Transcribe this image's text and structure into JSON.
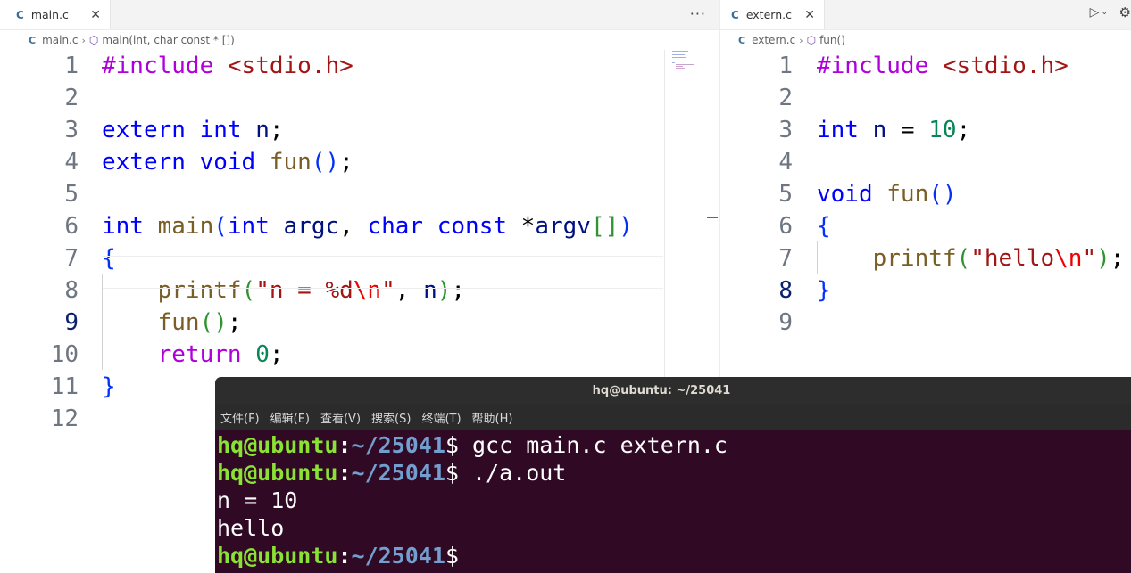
{
  "left_editor": {
    "tab": {
      "icon": "C",
      "label": "main.c"
    },
    "more_actions": "···",
    "breadcrumb": {
      "file_icon": "C",
      "file": "main.c",
      "symbol": "main(int, char const * [])"
    },
    "active_line": 9,
    "lines": [
      {
        "n": "1",
        "tokens": [
          {
            "t": "#include",
            "c": "inc"
          },
          {
            "t": " "
          },
          {
            "t": "<stdio.h>",
            "c": "str"
          }
        ]
      },
      {
        "n": "2",
        "tokens": []
      },
      {
        "n": "3",
        "tokens": [
          {
            "t": "extern",
            "c": "kw"
          },
          {
            "t": " "
          },
          {
            "t": "int",
            "c": "kw"
          },
          {
            "t": " "
          },
          {
            "t": "n",
            "c": "var"
          },
          {
            "t": ";"
          }
        ]
      },
      {
        "n": "4",
        "tokens": [
          {
            "t": "extern",
            "c": "kw"
          },
          {
            "t": " "
          },
          {
            "t": "void",
            "c": "kw"
          },
          {
            "t": " "
          },
          {
            "t": "fun",
            "c": "fn"
          },
          {
            "t": "()",
            "c": "br1"
          },
          {
            "t": ";"
          }
        ]
      },
      {
        "n": "5",
        "tokens": []
      },
      {
        "n": "6",
        "tokens": [
          {
            "t": "int",
            "c": "kw"
          },
          {
            "t": " "
          },
          {
            "t": "main",
            "c": "fn"
          },
          {
            "t": "(",
            "c": "br1"
          },
          {
            "t": "int",
            "c": "kw"
          },
          {
            "t": " "
          },
          {
            "t": "argc",
            "c": "var"
          },
          {
            "t": ", "
          },
          {
            "t": "char",
            "c": "kw"
          },
          {
            "t": " "
          },
          {
            "t": "const",
            "c": "kw"
          },
          {
            "t": " *"
          },
          {
            "t": "argv",
            "c": "var"
          },
          {
            "t": "[]",
            "c": "br2"
          },
          {
            "t": ")",
            "c": "br1"
          }
        ]
      },
      {
        "n": "7",
        "tokens": [
          {
            "t": "{",
            "c": "br1"
          }
        ]
      },
      {
        "n": "8",
        "tokens": [
          {
            "t": "    "
          },
          {
            "t": "printf",
            "c": "fn"
          },
          {
            "t": "(",
            "c": "br2"
          },
          {
            "t": "\"n = %d",
            "c": "str"
          },
          {
            "t": "\\n",
            "c": "esc"
          },
          {
            "t": "\"",
            "c": "str"
          },
          {
            "t": ", "
          },
          {
            "t": "n",
            "c": "var"
          },
          {
            "t": ")",
            "c": "br2"
          },
          {
            "t": ";"
          }
        ]
      },
      {
        "n": "9",
        "tokens": [
          {
            "t": "    "
          },
          {
            "t": "fun",
            "c": "fn"
          },
          {
            "t": "()",
            "c": "br2"
          },
          {
            "t": ";"
          }
        ]
      },
      {
        "n": "10",
        "tokens": [
          {
            "t": "    "
          },
          {
            "t": "return",
            "c": "ctl"
          },
          {
            "t": " "
          },
          {
            "t": "0",
            "c": "num"
          },
          {
            "t": ";"
          }
        ]
      },
      {
        "n": "11",
        "tokens": [
          {
            "t": "}",
            "c": "br1"
          }
        ]
      },
      {
        "n": "12",
        "tokens": []
      }
    ]
  },
  "right_editor": {
    "tab": {
      "icon": "C",
      "label": "extern.c"
    },
    "breadcrumb": {
      "file_icon": "C",
      "file": "extern.c",
      "symbol": "fun()"
    },
    "active_line": 8,
    "lines": [
      {
        "n": "1",
        "tokens": [
          {
            "t": "#include",
            "c": "inc"
          },
          {
            "t": " "
          },
          {
            "t": "<stdio.h>",
            "c": "str"
          }
        ]
      },
      {
        "n": "2",
        "tokens": []
      },
      {
        "n": "3",
        "tokens": [
          {
            "t": "int",
            "c": "kw"
          },
          {
            "t": " "
          },
          {
            "t": "n",
            "c": "var"
          },
          {
            "t": " = "
          },
          {
            "t": "10",
            "c": "num"
          },
          {
            "t": ";"
          }
        ]
      },
      {
        "n": "4",
        "tokens": []
      },
      {
        "n": "5",
        "tokens": [
          {
            "t": "void",
            "c": "kw"
          },
          {
            "t": " "
          },
          {
            "t": "fun",
            "c": "fn"
          },
          {
            "t": "()",
            "c": "br1"
          }
        ]
      },
      {
        "n": "6",
        "tokens": [
          {
            "t": "{",
            "c": "br1"
          }
        ]
      },
      {
        "n": "7",
        "tokens": [
          {
            "t": "    "
          },
          {
            "t": "printf",
            "c": "fn"
          },
          {
            "t": "(",
            "c": "br2"
          },
          {
            "t": "\"hello",
            "c": "str"
          },
          {
            "t": "\\n",
            "c": "esc"
          },
          {
            "t": "\"",
            "c": "str"
          },
          {
            "t": ")",
            "c": "br2"
          },
          {
            "t": ";"
          }
        ]
      },
      {
        "n": "8",
        "tokens": [
          {
            "t": "}",
            "c": "br1"
          }
        ]
      },
      {
        "n": "9",
        "tokens": []
      }
    ]
  },
  "terminal": {
    "title": "hq@ubuntu: ~/25041",
    "menu": [
      "文件(F)",
      "编辑(E)",
      "查看(V)",
      "搜索(S)",
      "终端(T)",
      "帮助(H)"
    ],
    "lines": [
      {
        "prompt": true,
        "user": "hq@ubuntu",
        "path": "~/25041",
        "cmd": " gcc main.c extern.c"
      },
      {
        "prompt": true,
        "user": "hq@ubuntu",
        "path": "~/25041",
        "cmd": " ./a.out"
      },
      {
        "prompt": false,
        "text": "n = 10"
      },
      {
        "prompt": false,
        "text": "hello"
      },
      {
        "prompt": true,
        "user": "hq@ubuntu",
        "path": "~/25041",
        "cmd": ""
      }
    ]
  }
}
